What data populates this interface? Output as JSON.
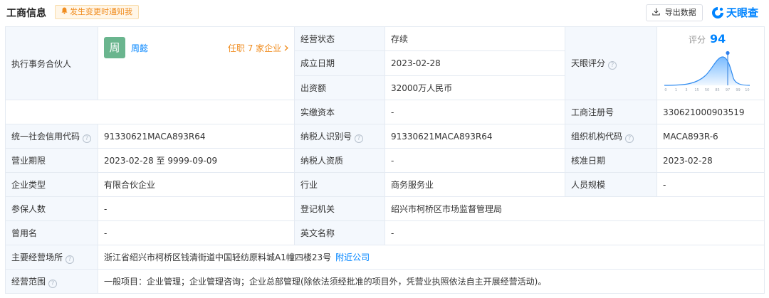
{
  "header": {
    "title": "工商信息",
    "notify_label": "发生变更时通知我",
    "export_label": "导出数据",
    "logo_text": "天眼查"
  },
  "table": {
    "executive_partner_label": "执行事务合伙人",
    "partner": {
      "avatar_char": "周",
      "name": "周懿",
      "tenure": "任职 7 家企业"
    },
    "status_label": "经营状态",
    "status_value": "存续",
    "founded_label": "成立日期",
    "founded_value": "2023-02-28",
    "capital_label": "出资额",
    "capital_value": "32000万人民币",
    "paid_label": "实缴资本",
    "paid_value": "-",
    "score_label": "天眼评分",
    "score": {
      "label": "评分",
      "value": "94",
      "value_num": 94,
      "ticks": [
        "0",
        "1",
        "3",
        "15",
        "50",
        "85",
        "97",
        "99",
        "100"
      ]
    },
    "reg_no_label": "工商注册号",
    "reg_no_value": "330621000903519",
    "credit_code_label": "统一社会信用代码",
    "credit_code_value": "91330621MACA893R64",
    "taxpayer_id_label": "纳税人识别号",
    "taxpayer_id_value": "91330621MACA893R64",
    "org_code_label": "组织机构代码",
    "org_code_value": "MACA893R-6",
    "term_label": "营业期限",
    "term_value": "2023-02-28 至 9999-09-09",
    "taxpayer_qual_label": "纳税人资质",
    "taxpayer_qual_value": "-",
    "approve_label": "核准日期",
    "approve_value": "2023-02-28",
    "type_label": "企业类型",
    "type_value": "有限合伙企业",
    "industry_label": "行业",
    "industry_value": "商务服务业",
    "staff_label": "人员规模",
    "staff_value": "-",
    "insured_label": "参保人数",
    "insured_value": "-",
    "authority_label": "登记机关",
    "authority_value": "绍兴市柯桥区市场监督管理局",
    "former_label": "曾用名",
    "former_value": "-",
    "english_label": "英文名称",
    "english_value": "-",
    "address_label": "主要经营场所",
    "address_value": "浙江省绍兴市柯桥区钱清街道中国轻纺原料城A1幢四楼23号",
    "nearby_label": "附近公司",
    "scope_label": "经营范围",
    "scope_value": "一般项目：企业管理；企业管理咨询；企业总部管理(除依法须经批准的项目外，凭营业执照依法自主开展经营活动)。"
  },
  "colors": {
    "accent": "#0084ff",
    "orange": "#f08c1e",
    "label_bg": "#f4f8fd",
    "border": "#e4eaf2"
  }
}
